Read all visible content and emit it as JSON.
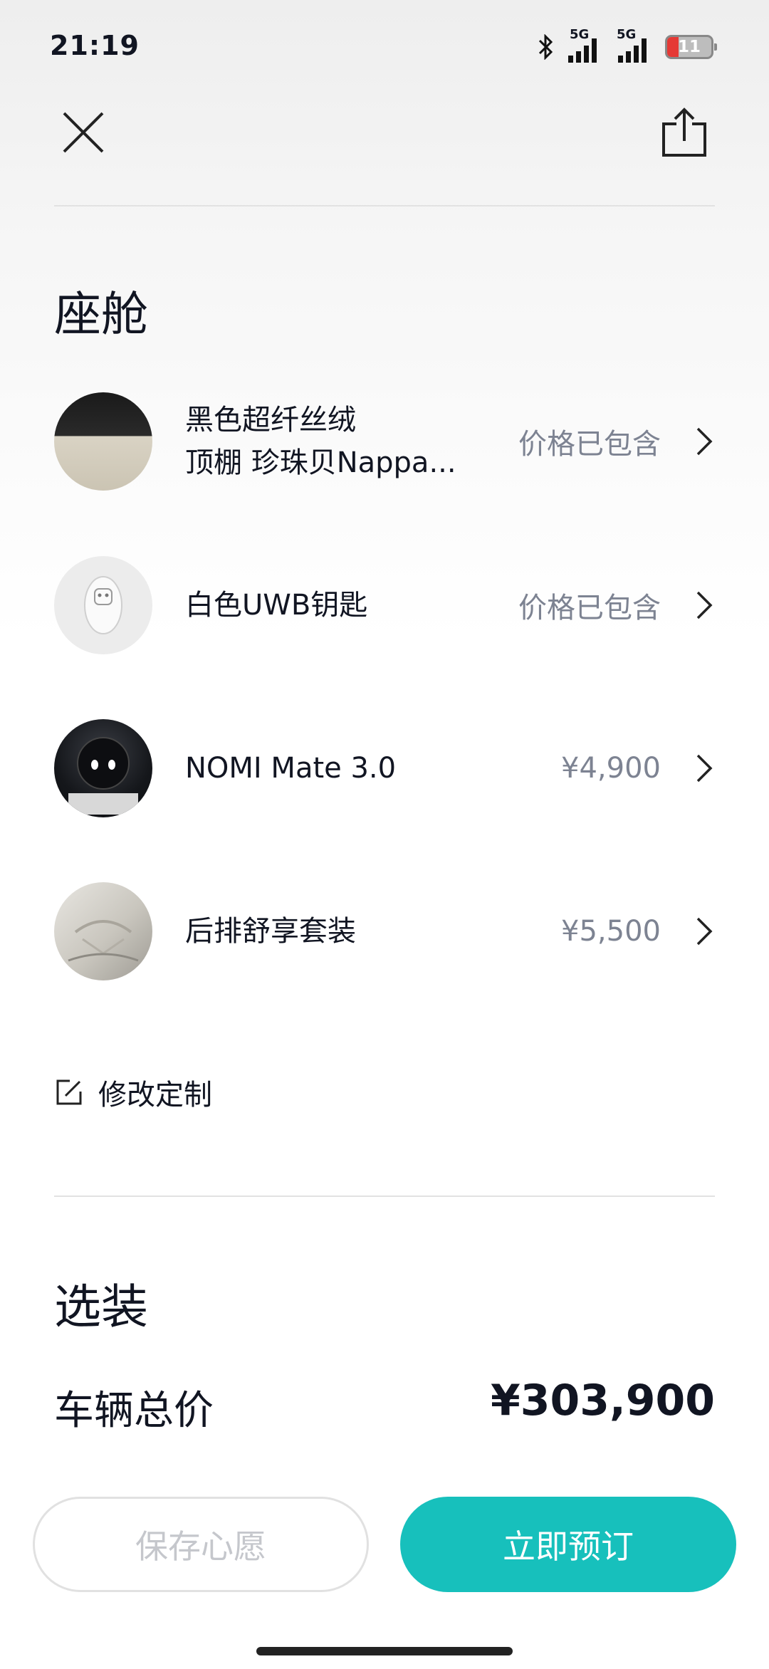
{
  "status": {
    "time": "21:19",
    "net1": "5G",
    "net2": "5G",
    "battery": "11"
  },
  "cockpit": {
    "title": "座舱",
    "items": [
      {
        "line1": "黑色超纤丝绒",
        "line2": "顶棚 珍珠贝Nappa...",
        "price": "价格已包含",
        "icon": "fabric-swatch-icon"
      },
      {
        "line1": "白色UWB钥匙",
        "price": "价格已包含",
        "icon": "uwb-key-icon"
      },
      {
        "line1": "NOMI Mate 3.0",
        "price": "¥4,900",
        "icon": "nomi-robot-icon"
      },
      {
        "line1": "后排舒享套装",
        "price": "¥5,500",
        "icon": "rear-seat-icon"
      }
    ],
    "edit_label": "修改定制"
  },
  "options": {
    "title": "选装"
  },
  "total": {
    "label": "车辆总价",
    "value": "¥303,900"
  },
  "buttons": {
    "save": "保存心愿",
    "book": "立即预订"
  },
  "colors": {
    "accent": "#17C0BC",
    "text": "#111522",
    "muted": "#7D8392"
  }
}
